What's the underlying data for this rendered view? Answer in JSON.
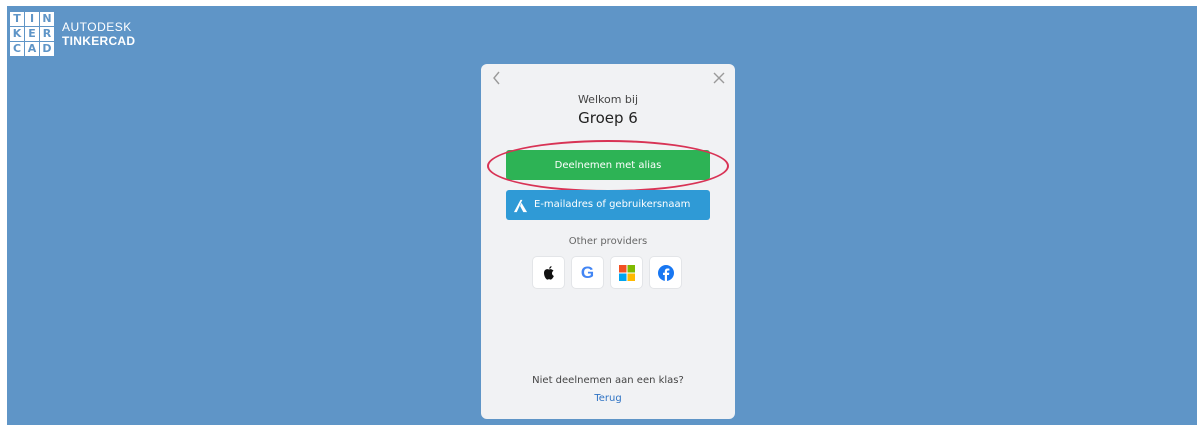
{
  "logo": {
    "grid_letters": [
      "T",
      "I",
      "N",
      "K",
      "E",
      "R",
      "C",
      "A",
      "D"
    ],
    "brand_line1": "AUTODESK",
    "brand_line2": "TINKERCAD"
  },
  "dialog": {
    "back_icon": "chevron-left-icon",
    "close_icon": "close-icon",
    "welcome": "Welkom bij",
    "group_name": "Groep 6",
    "join_alias_label": "Deelnemen met alias",
    "email_label": "E-mailadres of gebruikersnaam",
    "other_providers": "Other providers",
    "providers": [
      "apple-icon",
      "google-icon",
      "microsoft-icon",
      "facebook-icon"
    ],
    "not_join_text": "Niet deelnemen aan een klas?",
    "back_link": "Terug"
  },
  "colors": {
    "background": "#5f95c7",
    "alias_button": "#2db355",
    "email_button": "#2f9ad6",
    "highlight": "#d83355",
    "link": "#2f73c4"
  }
}
